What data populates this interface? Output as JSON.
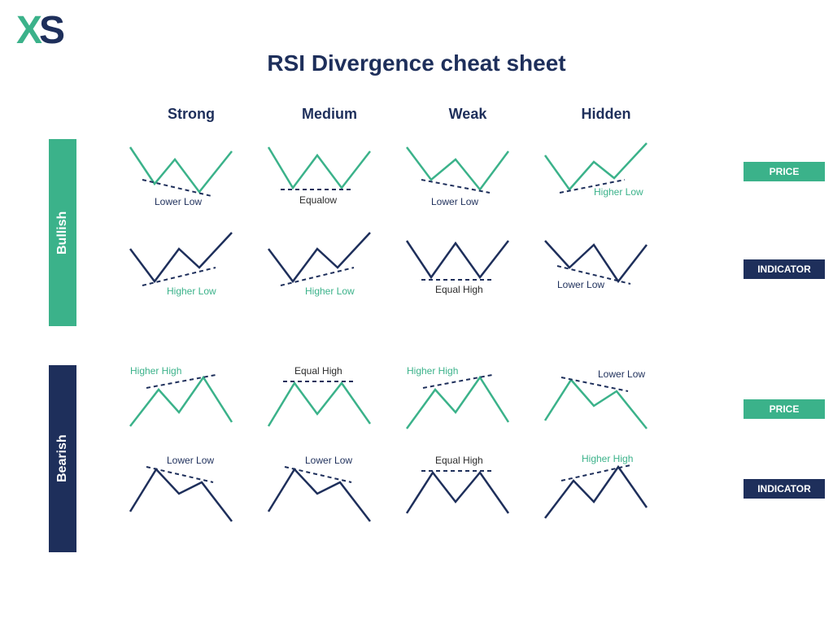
{
  "logo": {
    "x": "X",
    "s": "S"
  },
  "title": "RSI Divergence cheat sheet",
  "columns": [
    "Strong",
    "Medium",
    "Weak",
    "Hidden"
  ],
  "sections": {
    "bullish": {
      "label": "Bullish"
    },
    "bearish": {
      "label": "Bearish"
    }
  },
  "badges": {
    "price": "PRICE",
    "indicator": "INDICATOR"
  },
  "annotations": {
    "bullish_price": [
      "Lower Low",
      "Equalow",
      "Lower Low",
      "Higher Low"
    ],
    "bullish_indicator": [
      "Higher Low",
      "Higher Low",
      "Equal High",
      "Lower Low"
    ],
    "bearish_price": [
      "Higher High",
      "Equal High",
      "Higher High",
      "Lower Low"
    ],
    "bearish_indicator": [
      "Lower Low",
      "Lower Low",
      "Equal High",
      "Higher High"
    ]
  },
  "chart_data": {
    "type": "diagram",
    "description": "4x4 grid of schematic price/indicator zigzag patterns illustrating RSI divergence types",
    "rows": [
      "Bullish Price",
      "Bullish Indicator",
      "Bearish Price",
      "Bearish Indicator"
    ],
    "cols": [
      "Strong",
      "Medium",
      "Weak",
      "Hidden"
    ],
    "patterns": {
      "bullish_price": [
        {
          "shape": "W",
          "trough_relation": "second_lower",
          "trend": "down",
          "label": "Lower Low"
        },
        {
          "shape": "W",
          "trough_relation": "equal",
          "trend": "flat",
          "label": "Equalow"
        },
        {
          "shape": "W",
          "trough_relation": "second_lower",
          "trend": "down",
          "label": "Lower Low"
        },
        {
          "shape": "W",
          "trough_relation": "second_higher",
          "trend": "up",
          "label": "Higher Low"
        }
      ],
      "bullish_indicator": [
        {
          "shape": "W",
          "trough_relation": "second_higher",
          "trend": "up",
          "label": "Higher Low"
        },
        {
          "shape": "W",
          "trough_relation": "second_higher",
          "trend": "up",
          "label": "Higher Low"
        },
        {
          "shape": "W",
          "trough_relation": "equal",
          "trend": "flat",
          "label": "Equal High"
        },
        {
          "shape": "W",
          "trough_relation": "second_lower",
          "trend": "down",
          "label": "Lower Low"
        }
      ],
      "bearish_price": [
        {
          "shape": "M",
          "peak_relation": "second_higher",
          "trend": "up",
          "label": "Higher High"
        },
        {
          "shape": "M",
          "peak_relation": "equal",
          "trend": "flat",
          "label": "Equal High"
        },
        {
          "shape": "M",
          "peak_relation": "second_higher",
          "trend": "up",
          "label": "Higher High"
        },
        {
          "shape": "M",
          "peak_relation": "second_lower",
          "trend": "down",
          "label": "Lower Low"
        }
      ],
      "bearish_indicator": [
        {
          "shape": "M",
          "peak_relation": "second_lower",
          "trend": "down",
          "label": "Lower Low"
        },
        {
          "shape": "M",
          "peak_relation": "second_lower",
          "trend": "down",
          "label": "Lower Low"
        },
        {
          "shape": "M",
          "peak_relation": "equal",
          "trend": "flat",
          "label": "Equal High"
        },
        {
          "shape": "M",
          "peak_relation": "second_higher",
          "trend": "up",
          "label": "Higher High"
        }
      ]
    }
  }
}
